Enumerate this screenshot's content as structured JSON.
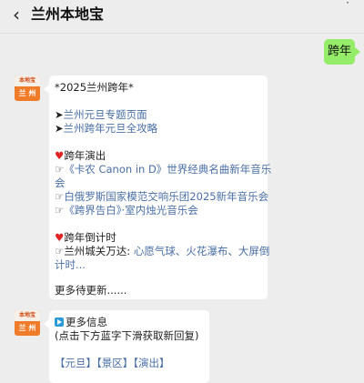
{
  "header": {
    "back_glyph": "‹",
    "title": "兰州本地宝",
    "more_glyph": "·"
  },
  "chat": {
    "user_message": "跨年",
    "bot_avatar": {
      "top_text": "本地宝",
      "bottom_text": "兰 州"
    },
    "reply1": {
      "heading": "*2025兰州跨年*",
      "links": [
        {
          "arrow": "➤",
          "text": "兰州元旦专题页面"
        },
        {
          "arrow": "➤",
          "text": "兰州跨年元旦全攻略"
        }
      ],
      "section1_heart": "♥",
      "section1_title": "跨年演出",
      "shows": [
        {
          "pen": "☞",
          "text": "《卡农 Canon in D》世界经典名曲新年音乐",
          "cont": "会"
        },
        {
          "pen": "☞",
          "text": "白俄罗斯国家模范交响乐团2025新年音乐会"
        },
        {
          "pen": "☞",
          "text": "《跨界告白》·室内烛光音乐会"
        }
      ],
      "section2_heart": "♥",
      "section2_title": "跨年倒计时",
      "countdown": {
        "pen": "☞",
        "prefix": "兰州城关万达: ",
        "link": "心愿气球、火花瀑布、大屏倒",
        "link_cont": "计时..."
      },
      "footer": "更多待更新......"
    },
    "reply2": {
      "title": "更多信息",
      "hint": "(点击下方蓝字下滑获取新回复)",
      "keywords": [
        "【元旦】",
        "【景区】",
        "【演出】"
      ]
    }
  }
}
